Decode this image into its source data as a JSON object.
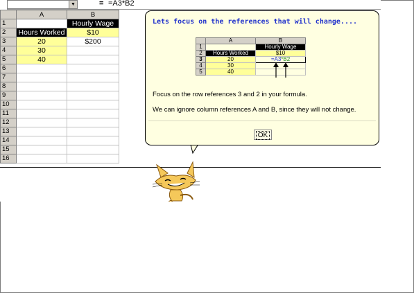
{
  "formula_bar": {
    "equals": "=",
    "formula": "=A3*B2"
  },
  "sheet": {
    "columns": [
      "A",
      "B"
    ],
    "rows": [
      "1",
      "2",
      "3",
      "4",
      "5",
      "6",
      "7",
      "8",
      "9",
      "10",
      "11",
      "12",
      "13",
      "14",
      "15",
      "16"
    ],
    "b1": "Hourly Wage",
    "a2": "Hours Worked",
    "b2": "$10",
    "a3": "20",
    "b3": "$200",
    "a4": "30",
    "a5": "40"
  },
  "balloon": {
    "title": "Lets focus on the references that will change....",
    "mini": {
      "columns": [
        "A",
        "B"
      ],
      "rows": [
        "1",
        "2",
        "3",
        "4",
        "5"
      ],
      "b1": "Hourly Wage",
      "a2": "Hours Worked",
      "b2": "$10",
      "a3": "20",
      "b3_prefix": "=A",
      "b3_row1": "3",
      "b3_star": "*B",
      "b3_row2": "2",
      "a4": "30",
      "a5": "40"
    },
    "paragraph1": "Focus on the row references 3 and 2 in your formula.",
    "paragraph2": "We can ignore column references A and B, since they will not change.",
    "ok_label": "OK"
  },
  "colors": {
    "balloon_bg": "#ffffe1",
    "title": "#2233cc",
    "highlight": "#ffff99"
  }
}
